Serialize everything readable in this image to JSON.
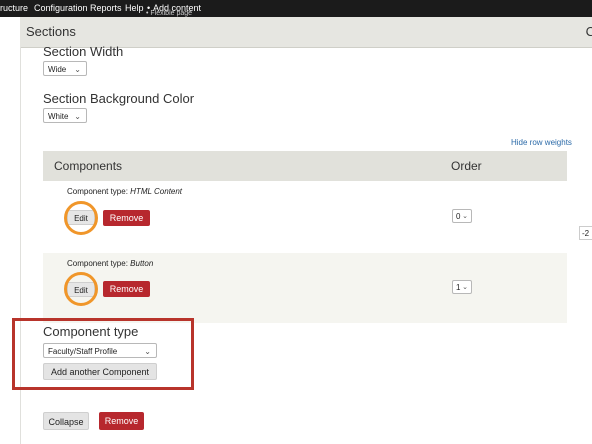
{
  "toolbar": {
    "items": [
      "ructure",
      "Configuration",
      "Reports",
      "Help",
      "Add content"
    ],
    "sub_text": "Flexible page"
  },
  "sections": {
    "title": "Sections",
    "right_glyph": "C"
  },
  "section_width": {
    "label": "Section Width",
    "value": "Wide"
  },
  "section_background": {
    "label": "Section Background Color",
    "value": "White"
  },
  "row_weights_link": "Hide row weights",
  "components_table": {
    "headers": [
      "Components",
      "Order"
    ],
    "rows": [
      {
        "type_prefix": "Component type: ",
        "type_name": "HTML Content",
        "edit_label": "Edit",
        "remove_label": "Remove",
        "order": "0"
      },
      {
        "type_prefix": "Component type: ",
        "type_name": "Button",
        "edit_label": "Edit",
        "remove_label": "Remove",
        "order": "1"
      }
    ]
  },
  "edge_value": "-2",
  "new_component": {
    "label": "Component type",
    "selected": "Faculty/Staff Profile",
    "add_button": "Add another Component"
  },
  "footer": {
    "collapse_label": "Collapse",
    "remove_label": "Remove"
  },
  "colors": {
    "toolbar_bg": "#1b1b1b",
    "remove_red": "#b7282e",
    "highlight_orange": "#f0962a",
    "callout_red": "#b8342b",
    "link_blue": "#2b6aa8"
  }
}
